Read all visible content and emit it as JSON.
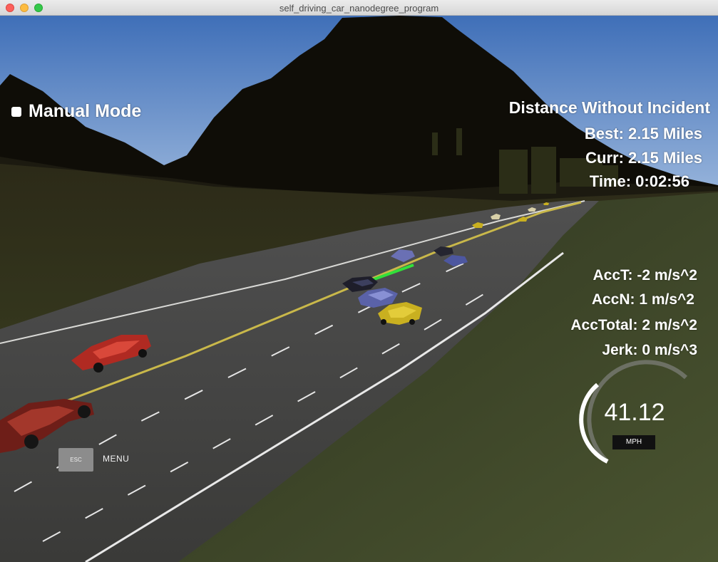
{
  "window": {
    "title": "self_driving_car_nanodegree_program"
  },
  "hud": {
    "mode_label": "Manual Mode",
    "distance_title": "Distance Without Incident",
    "best": "Best: 2.15 Miles",
    "current": "Curr: 2.15 Miles",
    "time": "Time: 0:02:56",
    "acc_t": "AccT: -2 m/s^2",
    "acc_n": "AccN: 1 m/s^2",
    "acc_total": "AccTotal: 2 m/s^2",
    "jerk": "Jerk: 0 m/s^3"
  },
  "speedometer": {
    "speed": "41.12",
    "unit": "MPH",
    "gauge_fill": 0.45
  },
  "menu": {
    "esc_label": "ESC",
    "menu_label": "MENU"
  },
  "colors": {
    "sky_top": "#3f6fb8",
    "sky_bottom": "#a7c0e0",
    "grass": "#3d4423",
    "road": "#3f3f3d",
    "path_line": "#32e03a",
    "ego_car": "#c9b020",
    "red_car": "#b02a22"
  }
}
